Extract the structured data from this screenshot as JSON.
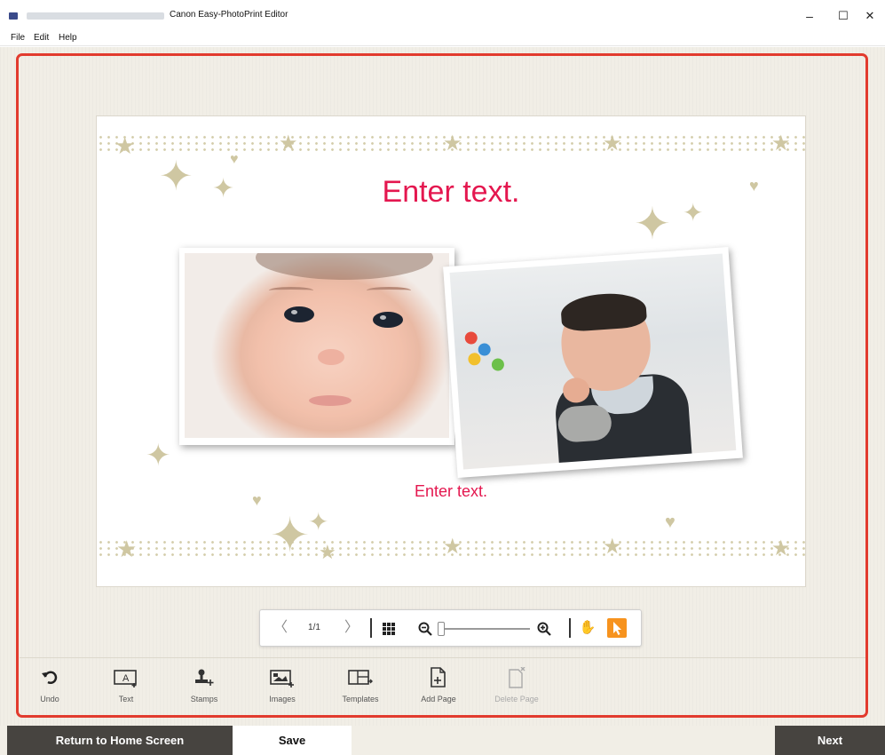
{
  "window": {
    "title": "Canon Easy-PhotoPrint Editor",
    "minimize_glyph": "–",
    "maximize_glyph": "☐",
    "close_glyph": "✕"
  },
  "menu": {
    "items": [
      "File",
      "Edit",
      "Help"
    ]
  },
  "canvas": {
    "headline": "Enter text.",
    "subline": "Enter text.",
    "text_color": "#e4174f"
  },
  "page_toolbar": {
    "prev_glyph": "〈",
    "page_indicator": "1/1",
    "next_glyph": "〉",
    "grid_icon": "grid-icon",
    "zoom_out_icon": "zoom-out-icon",
    "zoom_in_icon": "zoom-in-icon",
    "hand_icon": "hand-icon",
    "pointer_icon": "pointer-icon",
    "zoom_level": 0
  },
  "tools": [
    {
      "label": "Undo",
      "icon": "undo-icon",
      "glyph": "↶"
    },
    {
      "label": "Text",
      "icon": "text-icon",
      "glyph": "A"
    },
    {
      "label": "Stamps",
      "icon": "stamp-icon",
      "glyph": "♜"
    },
    {
      "label": "Images",
      "icon": "images-icon",
      "glyph": "▣"
    },
    {
      "label": "Templates",
      "icon": "templates-icon",
      "glyph": "⊟"
    },
    {
      "label": "Add Page",
      "icon": "add-page-icon",
      "glyph": "🗋"
    },
    {
      "label": "Delete Page",
      "icon": "delete-page-icon",
      "glyph": "🗋"
    }
  ],
  "bottom_nav": {
    "home": "Return to Home Screen",
    "save": "Save",
    "next": "Next"
  },
  "colors": {
    "accent": "#f7931e",
    "highlight_frame": "#e23b2e",
    "nav_dark": "#474440",
    "background": "#f1eee6"
  }
}
